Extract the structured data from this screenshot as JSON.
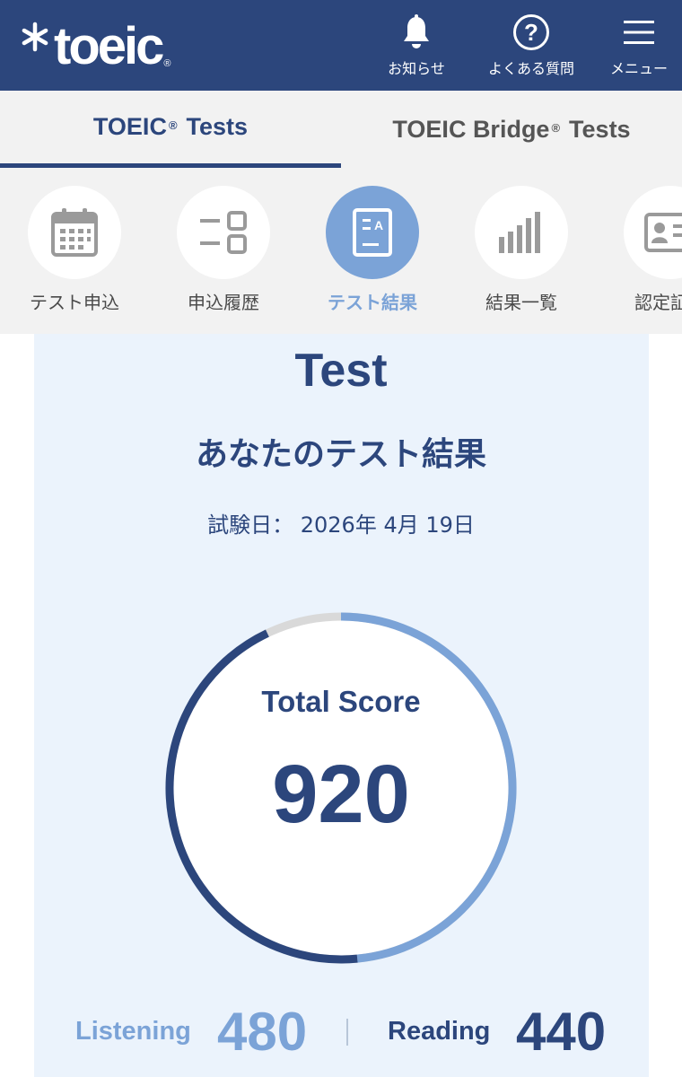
{
  "header": {
    "logo_text": "toeic",
    "notifications_label": "お知らせ",
    "faq_label": "よくある質問",
    "menu_label": "メニュー"
  },
  "tabs": [
    {
      "label": "TOEIC",
      "suffix": "Tests",
      "active": true
    },
    {
      "label": "TOEIC Bridge",
      "suffix": "Tests",
      "active": false
    }
  ],
  "subnav": [
    {
      "label": "テスト申込",
      "icon": "calendar-icon",
      "active": false
    },
    {
      "label": "申込履歴",
      "icon": "history-list-icon",
      "active": false
    },
    {
      "label": "テスト結果",
      "icon": "test-result-document-icon",
      "active": true
    },
    {
      "label": "結果一覧",
      "icon": "bar-chart-icon",
      "active": false
    },
    {
      "label": "認定証再",
      "icon": "id-card-icon",
      "active": false
    }
  ],
  "result": {
    "title": "Test",
    "subtitle": "あなたのテスト結果",
    "test_date": "試験日： 2026年 4月 19日",
    "total_label": "Total Score",
    "total_score": "920",
    "total_max": 990,
    "listening_label": "Listening",
    "listening_score": "480",
    "listening_max": 495,
    "reading_label": "Reading",
    "reading_score": "440",
    "reading_max": 495
  },
  "colors": {
    "brand_navy": "#2c467c",
    "accent_light_blue": "#7ba3d7",
    "card_background": "#ebf3fc",
    "tab_background": "#f2f2f2",
    "ring_track": "#d9d9d9"
  }
}
